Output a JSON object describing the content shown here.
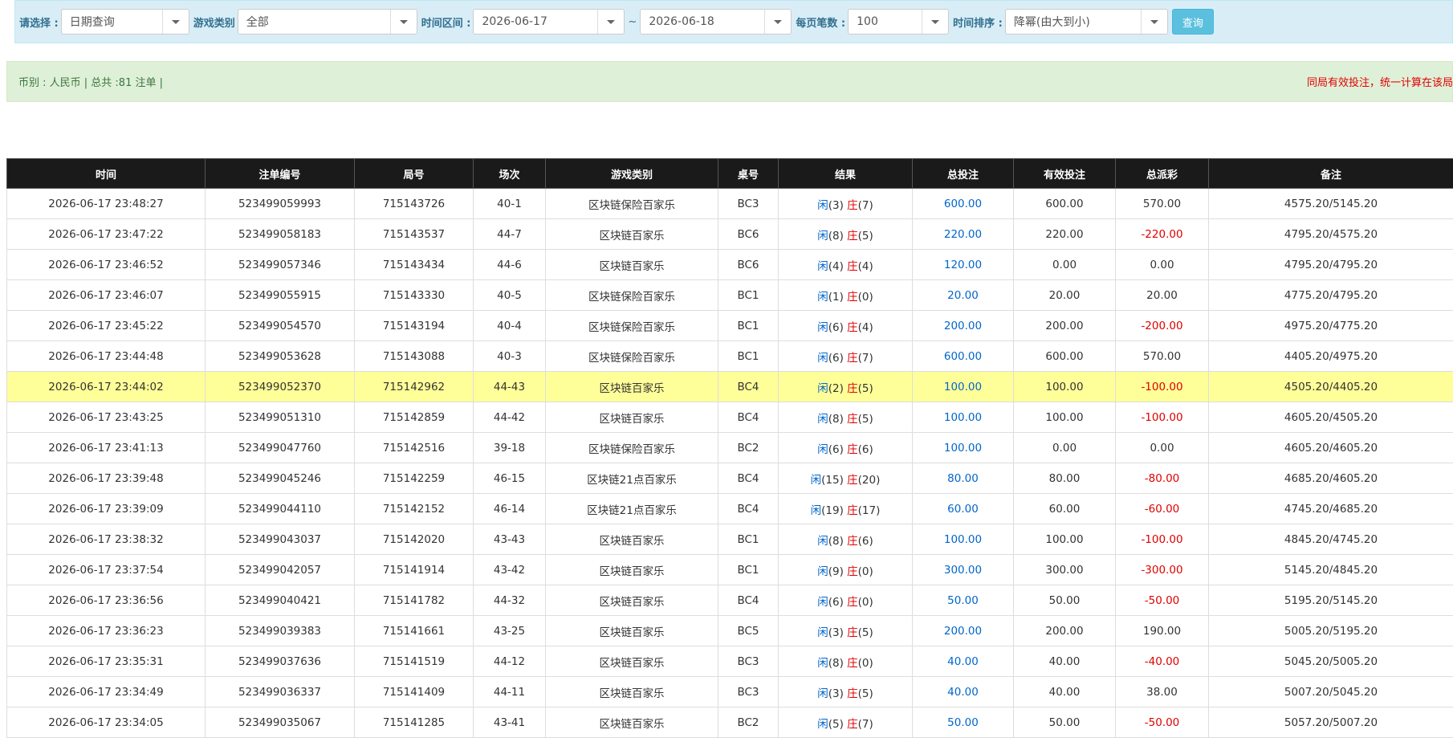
{
  "filters": {
    "select_label": "请选择 :",
    "select_value": "日期查询",
    "game_type_label": "游戏类别",
    "game_type_value": "全部",
    "range_label": "时间区间 :",
    "date_start": "2026-06-17",
    "tilde": "~",
    "date_end": "2026-06-18",
    "per_page_label": "每页笔数 :",
    "per_page_value": "100",
    "sort_label": "时间排序 :",
    "sort_value": "降幂(由大到小)",
    "query_button": "查询"
  },
  "summary": {
    "left": "币别 : 人民币 | 总共 :81 注单 |",
    "right": "同局有效投注，统一计算在该局第一张"
  },
  "table": {
    "headers": [
      "时间",
      "注单编号",
      "局号",
      "场次",
      "游戏类别",
      "桌号",
      "结果",
      "总投注",
      "有效投注",
      "总派彩",
      "备注"
    ],
    "player_label": "闲",
    "banker_label": "庄",
    "rows": [
      {
        "time": "2026-06-17 23:48:27",
        "bet_id": "523499059993",
        "round_id": "715143726",
        "shoe": "40-1",
        "game": "区块链保险百家乐",
        "table": "BC3",
        "p": "(3)",
        "b": "(7)",
        "total": "600.00",
        "valid": "600.00",
        "payout": "570.00",
        "payout_neg": false,
        "note": "4575.20/5145.20",
        "highlight": false
      },
      {
        "time": "2026-06-17 23:47:22",
        "bet_id": "523499058183",
        "round_id": "715143537",
        "shoe": "44-7",
        "game": "区块链百家乐",
        "table": "BC6",
        "p": "(8)",
        "b": "(5)",
        "total": "220.00",
        "valid": "220.00",
        "payout": "-220.00",
        "payout_neg": true,
        "note": "4795.20/4575.20",
        "highlight": false
      },
      {
        "time": "2026-06-17 23:46:52",
        "bet_id": "523499057346",
        "round_id": "715143434",
        "shoe": "44-6",
        "game": "区块链百家乐",
        "table": "BC6",
        "p": "(4)",
        "b": "(4)",
        "total": "120.00",
        "valid": "0.00",
        "payout": "0.00",
        "payout_neg": false,
        "note": "4795.20/4795.20",
        "highlight": false
      },
      {
        "time": "2026-06-17 23:46:07",
        "bet_id": "523499055915",
        "round_id": "715143330",
        "shoe": "40-5",
        "game": "区块链保险百家乐",
        "table": "BC1",
        "p": "(1)",
        "b": "(0)",
        "total": "20.00",
        "valid": "20.00",
        "payout": "20.00",
        "payout_neg": false,
        "note": "4775.20/4795.20",
        "highlight": false
      },
      {
        "time": "2026-06-17 23:45:22",
        "bet_id": "523499054570",
        "round_id": "715143194",
        "shoe": "40-4",
        "game": "区块链保险百家乐",
        "table": "BC1",
        "p": "(6)",
        "b": "(4)",
        "total": "200.00",
        "valid": "200.00",
        "payout": "-200.00",
        "payout_neg": true,
        "note": "4975.20/4775.20",
        "highlight": false
      },
      {
        "time": "2026-06-17 23:44:48",
        "bet_id": "523499053628",
        "round_id": "715143088",
        "shoe": "40-3",
        "game": "区块链保险百家乐",
        "table": "BC1",
        "p": "(6)",
        "b": "(7)",
        "total": "600.00",
        "valid": "600.00",
        "payout": "570.00",
        "payout_neg": false,
        "note": "4405.20/4975.20",
        "highlight": false
      },
      {
        "time": "2026-06-17 23:44:02",
        "bet_id": "523499052370",
        "round_id": "715142962",
        "shoe": "44-43",
        "game": "区块链百家乐",
        "table": "BC4",
        "p": "(2)",
        "b": "(5)",
        "total": "100.00",
        "valid": "100.00",
        "payout": "-100.00",
        "payout_neg": true,
        "note": "4505.20/4405.20",
        "highlight": true
      },
      {
        "time": "2026-06-17 23:43:25",
        "bet_id": "523499051310",
        "round_id": "715142859",
        "shoe": "44-42",
        "game": "区块链百家乐",
        "table": "BC4",
        "p": "(8)",
        "b": "(5)",
        "total": "100.00",
        "valid": "100.00",
        "payout": "-100.00",
        "payout_neg": true,
        "note": "4605.20/4505.20",
        "highlight": false
      },
      {
        "time": "2026-06-17 23:41:13",
        "bet_id": "523499047760",
        "round_id": "715142516",
        "shoe": "39-18",
        "game": "区块链保险百家乐",
        "table": "BC2",
        "p": "(6)",
        "b": "(6)",
        "total": "100.00",
        "valid": "0.00",
        "payout": "0.00",
        "payout_neg": false,
        "note": "4605.20/4605.20",
        "highlight": false
      },
      {
        "time": "2026-06-17 23:39:48",
        "bet_id": "523499045246",
        "round_id": "715142259",
        "shoe": "46-15",
        "game": "区块链21点百家乐",
        "table": "BC4",
        "p": "(15)",
        "b": "(20)",
        "total": "80.00",
        "valid": "80.00",
        "payout": "-80.00",
        "payout_neg": true,
        "note": "4685.20/4605.20",
        "highlight": false
      },
      {
        "time": "2026-06-17 23:39:09",
        "bet_id": "523499044110",
        "round_id": "715142152",
        "shoe": "46-14",
        "game": "区块链21点百家乐",
        "table": "BC4",
        "p": "(19)",
        "b": "(17)",
        "total": "60.00",
        "valid": "60.00",
        "payout": "-60.00",
        "payout_neg": true,
        "note": "4745.20/4685.20",
        "highlight": false
      },
      {
        "time": "2026-06-17 23:38:32",
        "bet_id": "523499043037",
        "round_id": "715142020",
        "shoe": "43-43",
        "game": "区块链百家乐",
        "table": "BC1",
        "p": "(8)",
        "b": "(6)",
        "total": "100.00",
        "valid": "100.00",
        "payout": "-100.00",
        "payout_neg": true,
        "note": "4845.20/4745.20",
        "highlight": false
      },
      {
        "time": "2026-06-17 23:37:54",
        "bet_id": "523499042057",
        "round_id": "715141914",
        "shoe": "43-42",
        "game": "区块链百家乐",
        "table": "BC1",
        "p": "(9)",
        "b": "(0)",
        "total": "300.00",
        "valid": "300.00",
        "payout": "-300.00",
        "payout_neg": true,
        "note": "5145.20/4845.20",
        "highlight": false
      },
      {
        "time": "2026-06-17 23:36:56",
        "bet_id": "523499040421",
        "round_id": "715141782",
        "shoe": "44-32",
        "game": "区块链百家乐",
        "table": "BC4",
        "p": "(6)",
        "b": "(0)",
        "total": "50.00",
        "valid": "50.00",
        "payout": "-50.00",
        "payout_neg": true,
        "note": "5195.20/5145.20",
        "highlight": false
      },
      {
        "time": "2026-06-17 23:36:23",
        "bet_id": "523499039383",
        "round_id": "715141661",
        "shoe": "43-25",
        "game": "区块链百家乐",
        "table": "BC5",
        "p": "(3)",
        "b": "(5)",
        "total": "200.00",
        "valid": "200.00",
        "payout": "190.00",
        "payout_neg": false,
        "note": "5005.20/5195.20",
        "highlight": false
      },
      {
        "time": "2026-06-17 23:35:31",
        "bet_id": "523499037636",
        "round_id": "715141519",
        "shoe": "44-12",
        "game": "区块链百家乐",
        "table": "BC3",
        "p": "(8)",
        "b": "(0)",
        "total": "40.00",
        "valid": "40.00",
        "payout": "-40.00",
        "payout_neg": true,
        "note": "5045.20/5005.20",
        "highlight": false
      },
      {
        "time": "2026-06-17 23:34:49",
        "bet_id": "523499036337",
        "round_id": "715141409",
        "shoe": "44-11",
        "game": "区块链百家乐",
        "table": "BC3",
        "p": "(3)",
        "b": "(5)",
        "total": "40.00",
        "valid": "40.00",
        "payout": "38.00",
        "payout_neg": false,
        "note": "5007.20/5045.20",
        "highlight": false
      },
      {
        "time": "2026-06-17 23:34:05",
        "bet_id": "523499035067",
        "round_id": "715141285",
        "shoe": "43-41",
        "game": "区块链百家乐",
        "table": "BC2",
        "p": "(5)",
        "b": "(7)",
        "total": "50.00",
        "valid": "50.00",
        "payout": "-50.00",
        "payout_neg": true,
        "note": "5057.20/5007.20",
        "highlight": false
      }
    ]
  }
}
